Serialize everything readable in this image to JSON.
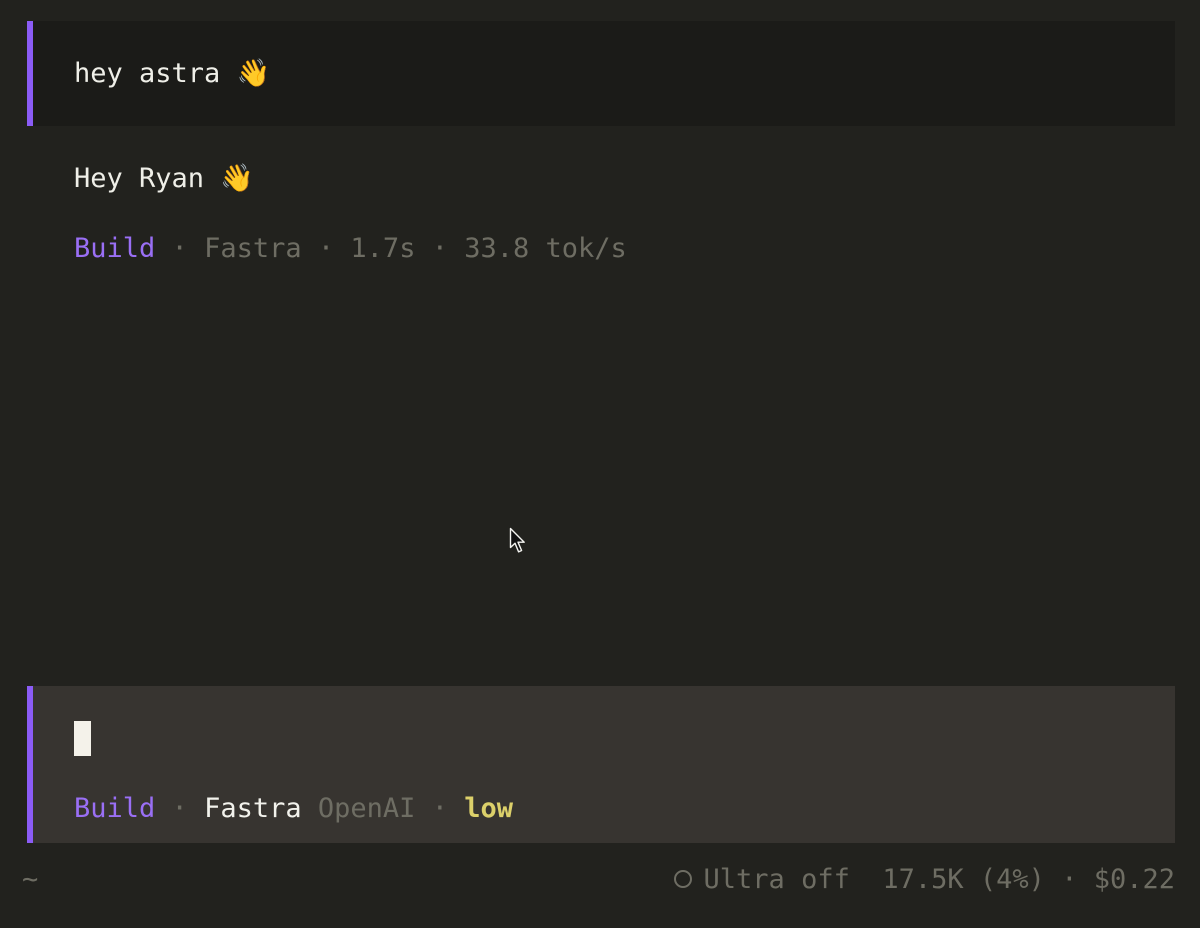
{
  "conversation": {
    "user_message": "hey astra 👋",
    "assistant_message": "Hey Ryan 👋",
    "assistant_meta": {
      "mode": "Build",
      "model": "Fastra",
      "duration": "1.7s",
      "speed": "33.8 tok/s"
    }
  },
  "input": {
    "mode": "Build",
    "model": "Fastra",
    "provider": "OpenAI",
    "effort": "low"
  },
  "status_bar": {
    "cwd": "~",
    "ultra": "Ultra off",
    "tokens": "17.5K (4%)",
    "cost": "$0.22"
  },
  "separator": "·",
  "colors": {
    "accent": "#9a6ff5",
    "accent_bar": "#8b5cf6",
    "effort": "#dcd06a",
    "muted": "#6e6d63",
    "background": "#22221e",
    "input_background": "#373430"
  }
}
